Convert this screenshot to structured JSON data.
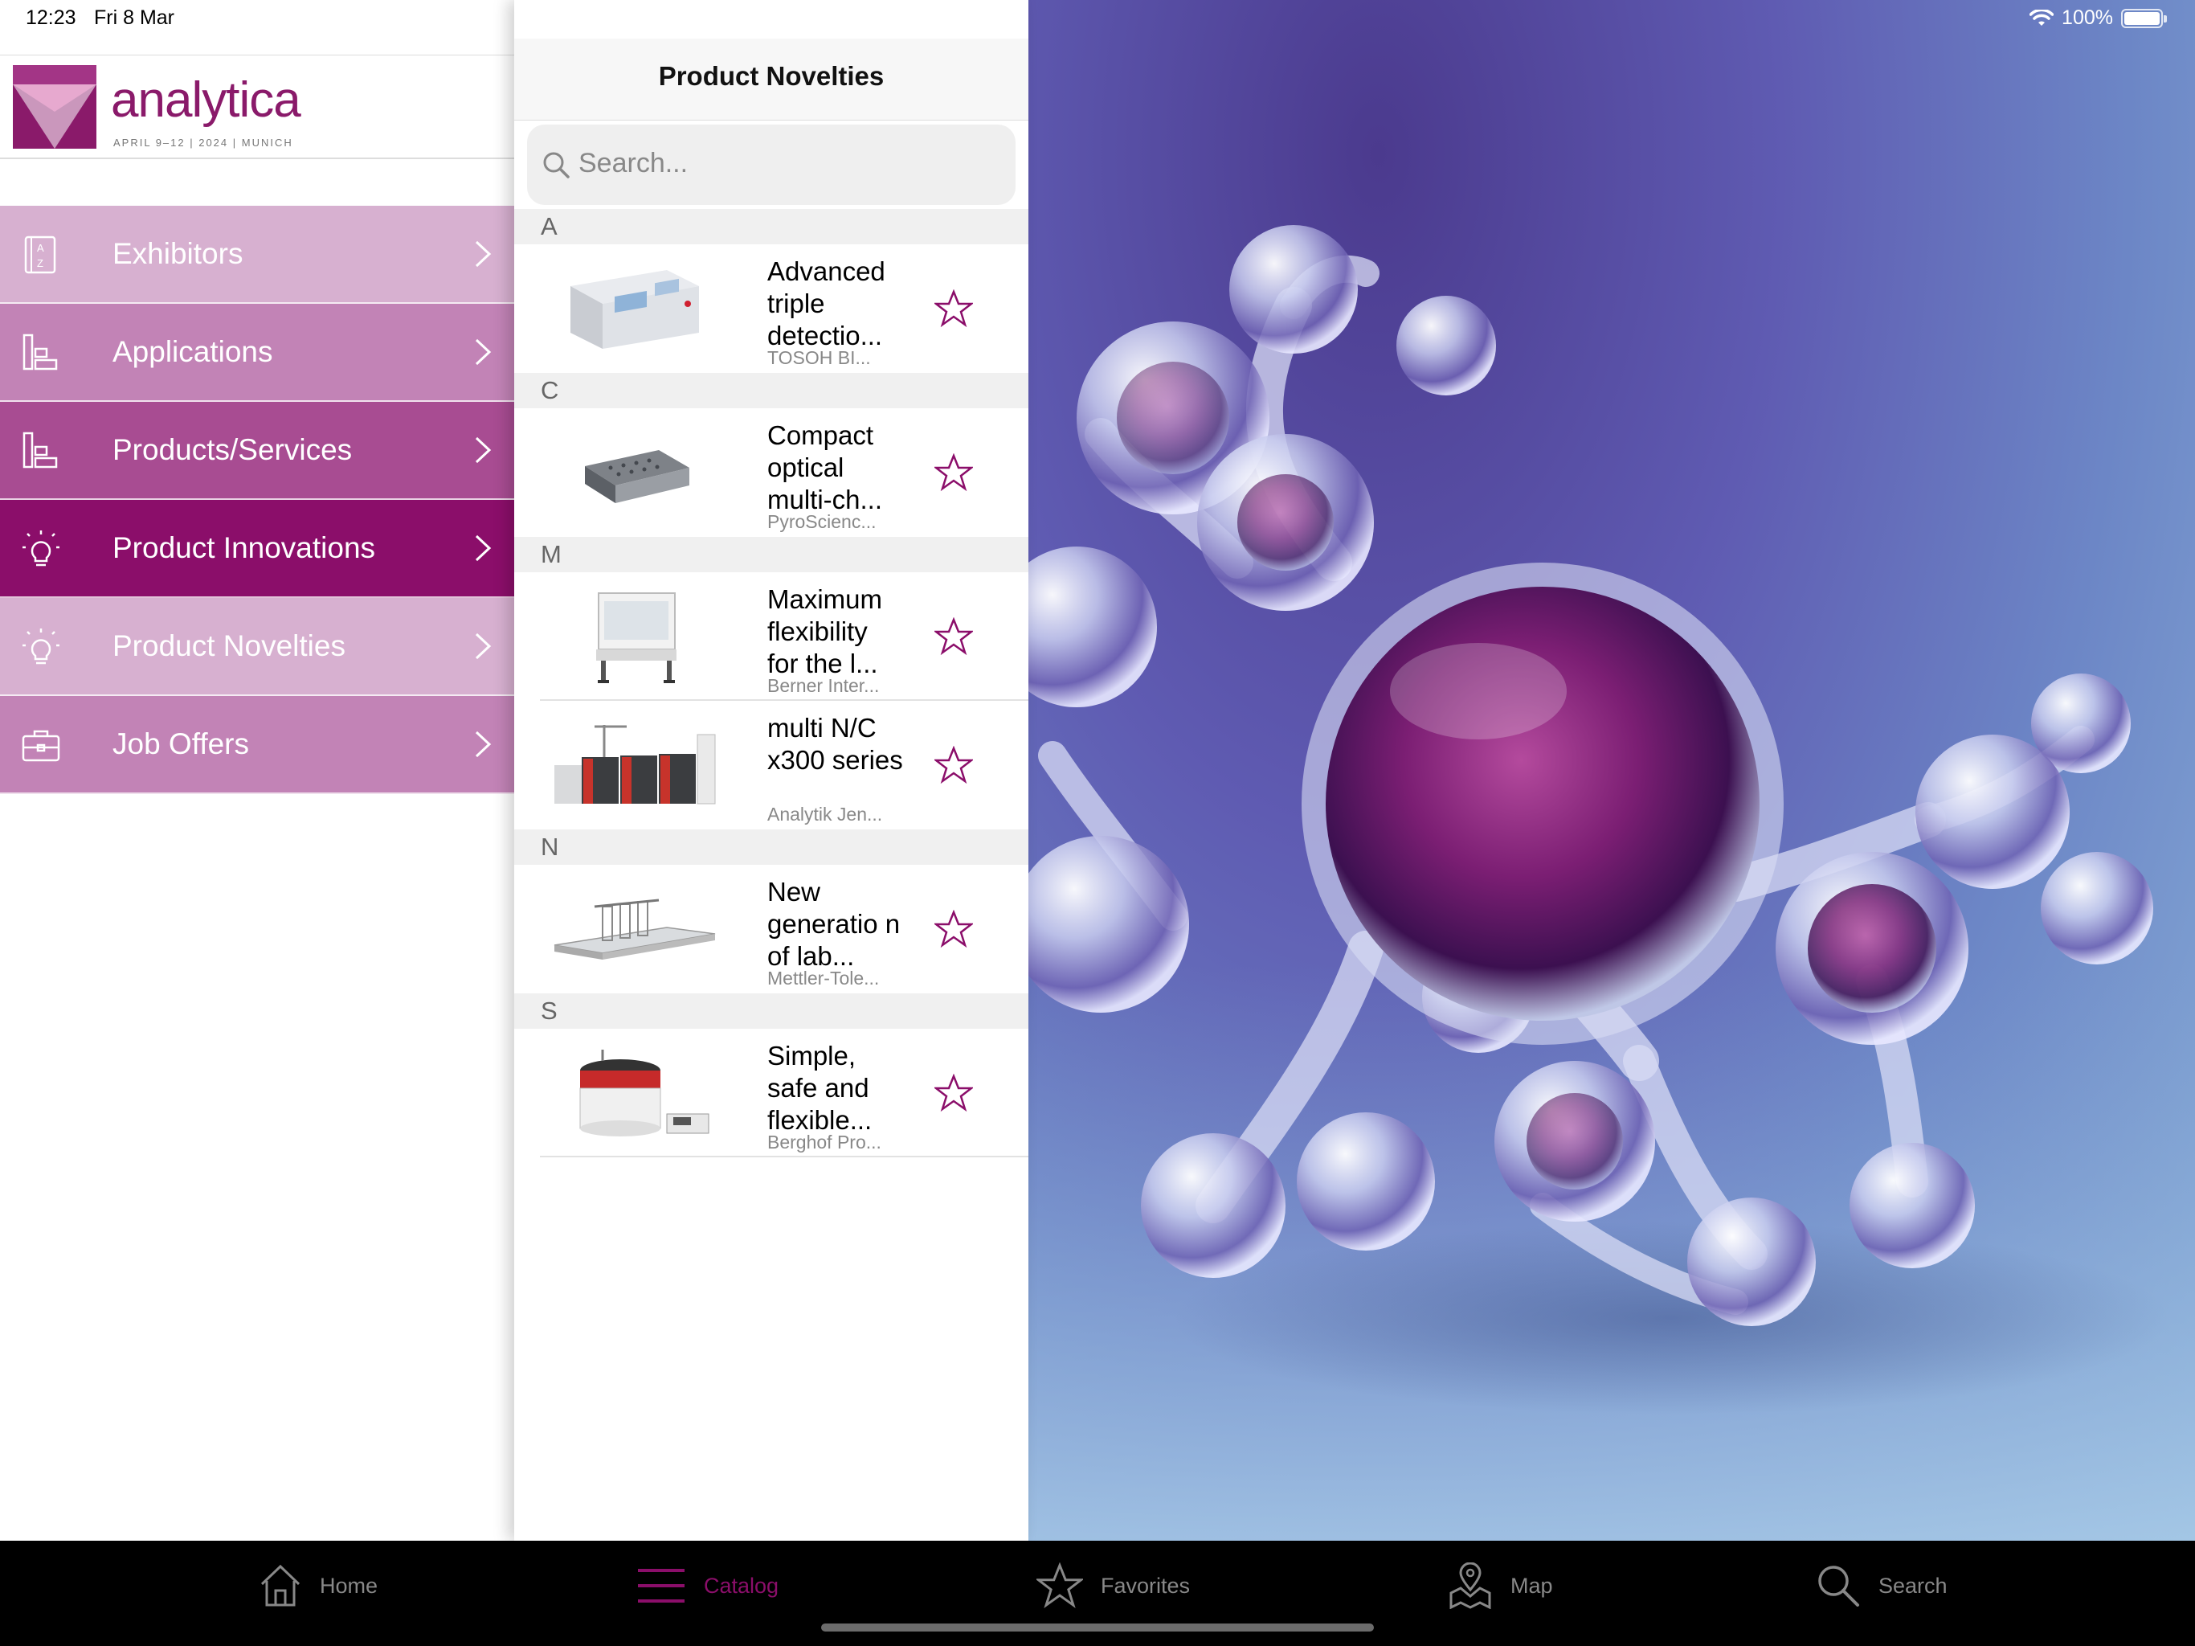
{
  "status": {
    "time": "12:23",
    "date": "Fri 8 Mar",
    "battery": "100%"
  },
  "logo": {
    "name": "analytica",
    "tagline": "APRIL 9–12 | 2024 | MUNICH"
  },
  "menu": [
    {
      "label": "Exhibitors",
      "icon": "az-directory-icon"
    },
    {
      "label": "Applications",
      "icon": "applications-icon"
    },
    {
      "label": "Products/Services",
      "icon": "products-icon"
    },
    {
      "label": "Product Innovations",
      "icon": "lightbulb-icon",
      "selected": true
    },
    {
      "label": "Product Novelties",
      "icon": "lightbulb-icon"
    },
    {
      "label": "Job Offers",
      "icon": "briefcase-icon"
    }
  ],
  "panel": {
    "title": "Product Novelties",
    "search_placeholder": "Search..."
  },
  "sections": [
    {
      "letter": "A",
      "items": [
        {
          "title": "Advanced triple detectio...",
          "company": "TOSOH BI..."
        }
      ]
    },
    {
      "letter": "C",
      "items": [
        {
          "title": "Compact optical multi-ch...",
          "company": "PyroScienc..."
        }
      ]
    },
    {
      "letter": "M",
      "items": [
        {
          "title": "Maximum flexibility for the l...",
          "company": "Berner Inter..."
        },
        {
          "title": "multi N/C x300 series",
          "company": "Analytik Jen..."
        }
      ]
    },
    {
      "letter": "N",
      "items": [
        {
          "title": "New generatio n of lab...",
          "company": "Mettler-Tole..."
        }
      ]
    },
    {
      "letter": "S",
      "items": [
        {
          "title": "Simple, safe and flexible...",
          "company": "Berghof Pro..."
        }
      ]
    }
  ],
  "tabs": [
    {
      "label": "Home",
      "icon": "home-icon"
    },
    {
      "label": "Catalog",
      "icon": "catalog-icon",
      "active": true
    },
    {
      "label": "Favorites",
      "icon": "star-icon"
    },
    {
      "label": "Map",
      "icon": "map-icon"
    },
    {
      "label": "Search",
      "icon": "search-icon"
    }
  ],
  "colors": {
    "brand": "#8b0e6a",
    "menu_light": "#d7b0d0",
    "menu_mid": "#c283b6",
    "menu_dark": "#a84c92"
  }
}
